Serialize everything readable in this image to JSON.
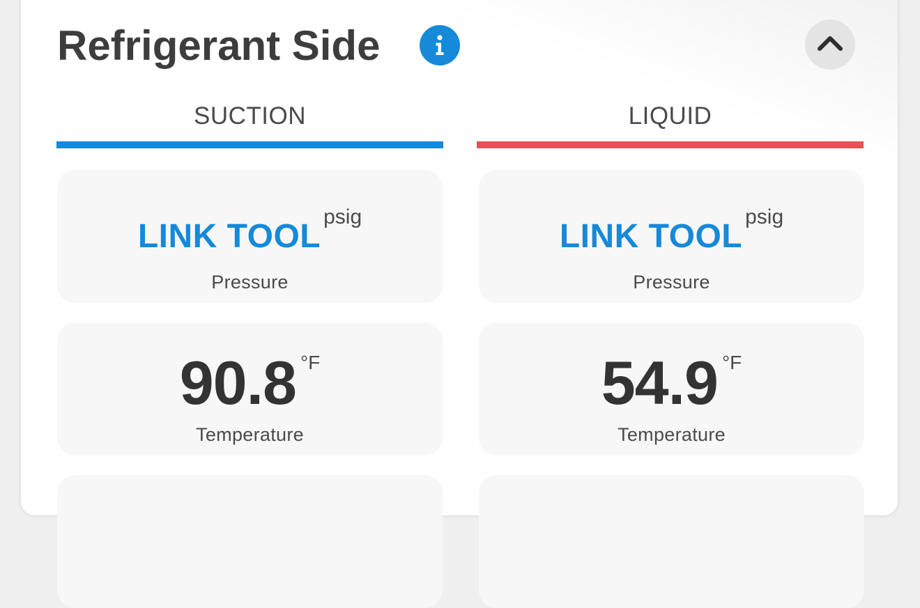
{
  "section": {
    "title": "Refrigerant Side",
    "info_icon": "info-icon",
    "collapse_icon": "chevron-up-icon"
  },
  "columns": [
    {
      "header": "SUCTION",
      "accent_color": "#1689d9",
      "pressure": {
        "value": "LINK TOOL",
        "unit": "psig",
        "label": "Pressure"
      },
      "temperature": {
        "value": "90.8",
        "unit": "°F",
        "label": "Temperature"
      }
    },
    {
      "header": "LIQUID",
      "accent_color": "#e45457",
      "pressure": {
        "value": "LINK TOOL",
        "unit": "psig",
        "label": "Pressure"
      },
      "temperature": {
        "value": "54.9",
        "unit": "°F",
        "label": "Temperature"
      }
    }
  ],
  "colors": {
    "link_blue": "#1689d9",
    "tile_background": "#f7f7f7",
    "text_dark": "#333333"
  }
}
